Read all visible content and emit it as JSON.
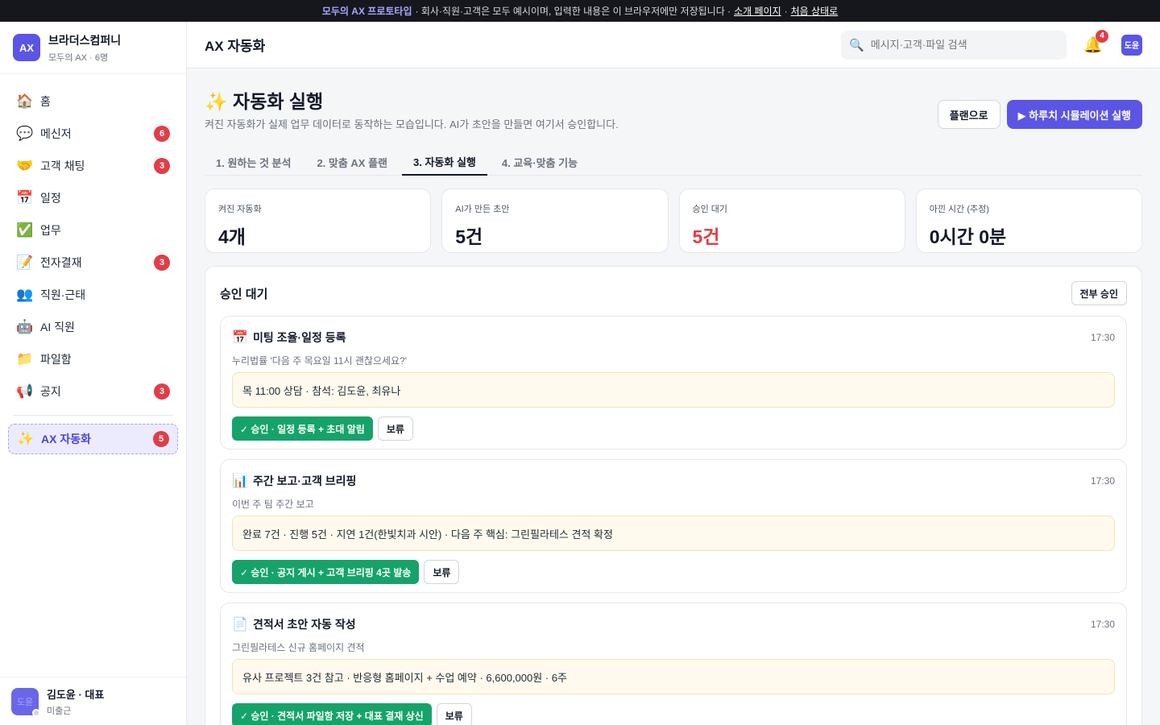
{
  "banner": {
    "highlight": "모두의 AX 프로토타입",
    "text": "· 회사·직원·고객은 모두 예시이며, 입력한 내용은 이 브라우저에만 저장됩니다 ·",
    "link_intro": "소개 페이지",
    "sep": "·",
    "link_reset": "처음 상태로"
  },
  "brand": {
    "logo": "AX",
    "name": "브라더스컴퍼니",
    "sub": "모두의 AX · 6명"
  },
  "sidebar": {
    "items": [
      {
        "icon": "🏠",
        "icon_name": "home-icon",
        "label": "홈",
        "badge": ""
      },
      {
        "icon": "💬",
        "icon_name": "speech-bubble-icon",
        "label": "메신저",
        "badge": "6"
      },
      {
        "icon": "🤝",
        "icon_name": "handshake-icon",
        "label": "고객 채팅",
        "badge": "3"
      },
      {
        "icon": "📅",
        "icon_name": "calendar-icon",
        "label": "일정",
        "badge": ""
      },
      {
        "icon": "✅",
        "icon_name": "check-box-icon",
        "label": "업무",
        "badge": ""
      },
      {
        "icon": "📝",
        "icon_name": "memo-icon",
        "label": "전자결재",
        "badge": "3"
      },
      {
        "icon": "👥",
        "icon_name": "people-icon",
        "label": "직원·근태",
        "badge": ""
      },
      {
        "icon": "🤖",
        "icon_name": "robot-icon",
        "label": "AI 직원",
        "badge": ""
      },
      {
        "icon": "📁",
        "icon_name": "folder-icon",
        "label": "파일함",
        "badge": ""
      },
      {
        "icon": "📢",
        "icon_name": "megaphone-icon",
        "label": "공지",
        "badge": "3"
      }
    ],
    "active": {
      "icon": "✨",
      "icon_name": "sparkles-icon",
      "label": "AX 자동화",
      "badge": "5"
    }
  },
  "user": {
    "avatar": "도윤",
    "name": "김도윤 · 대표",
    "status": "미출근"
  },
  "topbar": {
    "title": "AX 자동화",
    "search_placeholder": "메시지·고객·파일 검색",
    "notif_count": "4",
    "avatar": "도윤"
  },
  "page": {
    "title": "✨ 자동화 실행",
    "subtitle": "켜진 자동화가 실제 업무 데이터로 동작하는 모습입니다. AI가 초안을 만들면 여기서 승인합니다.",
    "btn_plan": "플랜으로",
    "btn_simulate": "▶ 하루치 시뮬레이션 실행"
  },
  "tabs": [
    {
      "label": "1. 원하는 것 분석",
      "active": false
    },
    {
      "label": "2. 맞춤 AX 플랜",
      "active": false
    },
    {
      "label": "3. 자동화 실행",
      "active": true
    },
    {
      "label": "4. 교육·맞춤 기능",
      "active": false
    }
  ],
  "stats": [
    {
      "label": "켜진 자동화",
      "value": "4개",
      "red": false
    },
    {
      "label": "AI가 만든 초안",
      "value": "5건",
      "red": false
    },
    {
      "label": "승인 대기",
      "value": "5건",
      "red": true
    },
    {
      "label": "아낀 시간 (추정)",
      "value": "0시간 0분",
      "red": false
    }
  ],
  "approval": {
    "title": "승인 대기",
    "approve_all": "전부 승인",
    "items": [
      {
        "icon": "📅",
        "icon_name": "calendar-icon",
        "title": "미팅 조율·일정 등록",
        "time": "17:30",
        "desc": "누리법률 '다음 주 목요일 11시 괜찮으세요?'",
        "draft": "목 11:00 상담 · 참석: 김도윤, 최유나",
        "approve": "✓ 승인 · 일정 등록 + 초대 알림",
        "hold": "보류"
      },
      {
        "icon": "📊",
        "icon_name": "bar-chart-icon",
        "title": "주간 보고·고객 브리핑",
        "time": "17:30",
        "desc": "이번 주 팀 주간 보고",
        "draft": "완료 7건 · 진행 5건 · 지연 1건(한빛치과 시안) · 다음 주 핵심: 그린필라테스 견적 확정",
        "approve": "✓ 승인 · 공지 게시 + 고객 브리핑 4곳 발송",
        "hold": "보류"
      },
      {
        "icon": "📄",
        "icon_name": "document-icon",
        "title": "견적서 초안 자동 작성",
        "time": "17:30",
        "desc": "그린필라테스 신규 홈페이지 견적",
        "draft": "유사 프로젝트 3건 참고 · 반응형 홈페이지 + 수업 예약 · 6,600,000원 · 6주",
        "approve": "✓ 승인 · 견적서 파일함 저장 + 대표 결재 상신",
        "hold": "보류"
      }
    ]
  },
  "colors": {
    "accent": "#5b55e6",
    "danger": "#e03e47",
    "success": "#16a36a",
    "draft_bg": "#fffaed"
  }
}
